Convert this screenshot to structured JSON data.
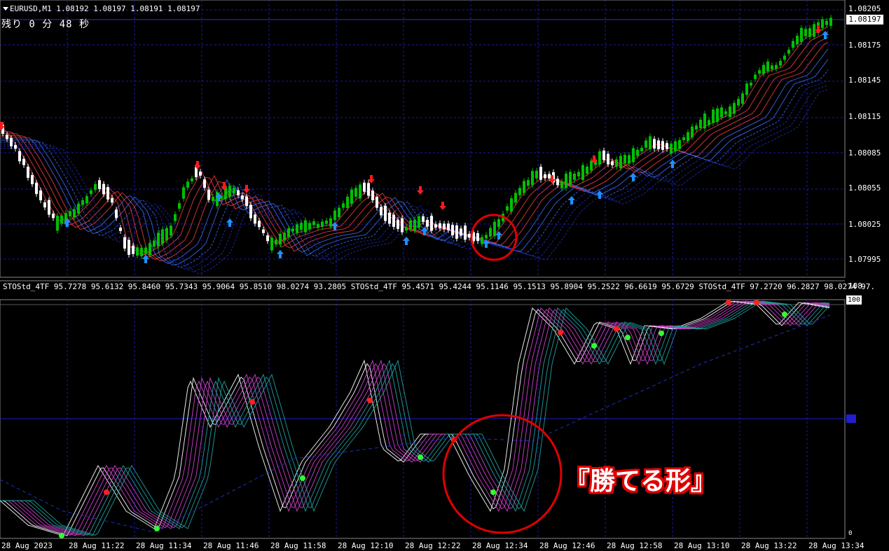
{
  "chart": {
    "symbol": "EURUSD,M1",
    "ohlc": "1.08192 1.08197 1.08191 1.08197",
    "countdown": "残り 0 分 48 秒",
    "current_price": "1.08197",
    "price_ticks": [
      "1.08205",
      "1.08175",
      "1.08145",
      "1.08115",
      "1.08085",
      "1.08055",
      "1.08025",
      "1.07995"
    ]
  },
  "indicator": {
    "label": "STOStd_4TF 95.7278 95.6132 95.8460 95.7343 95.9064 95.8510 98.0274 93.2805  STOStd_4TF 95.4571 95.4244 95.1146 95.1513 95.8904 95.2522 96.6619 95.6729  STOStd_4TF 97.2720 96.2827 98.0274 97.",
    "scale_top": "108",
    "level_100": "100",
    "level_50": "50",
    "scale_bottom": "0"
  },
  "time_axis": [
    "28 Aug 2023",
    "28 Aug 11:22",
    "28 Aug 11:34",
    "28 Aug 11:46",
    "28 Aug 11:58",
    "28 Aug 12:10",
    "28 Aug 12:22",
    "28 Aug 12:34",
    "28 Aug 12:46",
    "28 Aug 12:58",
    "28 Aug 13:10",
    "28 Aug 13:22",
    "28 Aug 13:34"
  ],
  "callout": "『勝てる形』",
  "colors": {
    "background": "#000000",
    "grid": "#1a1aa8",
    "bull_candle": "#00c000",
    "bear_candle": "#ffffff",
    "buy_arrow": "#1e90ff",
    "sell_arrow": "#ff1a1a",
    "highlight_circle": "#e00000",
    "stoch_fast": "#ffffff",
    "stoch_mid": "#d040d0",
    "stoch_slow": "#20a0a0"
  }
}
